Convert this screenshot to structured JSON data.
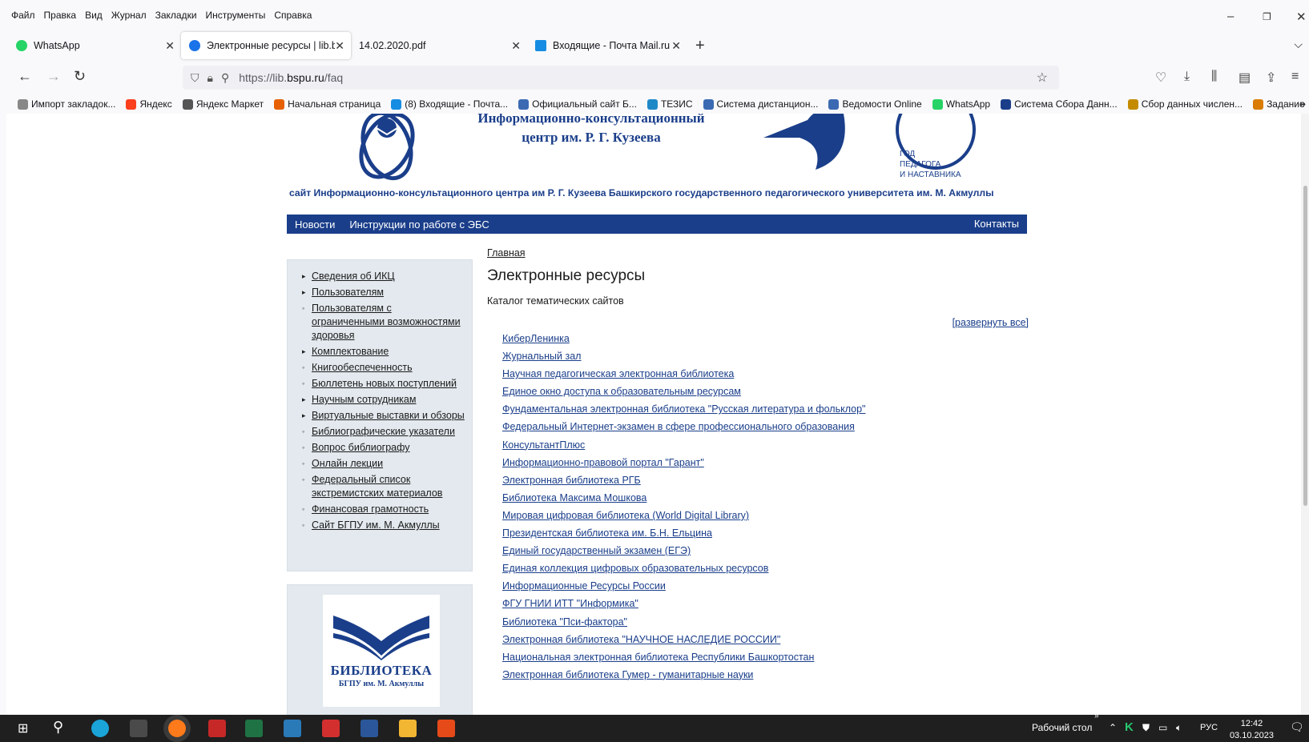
{
  "menu": [
    "Файл",
    "Правка",
    "Вид",
    "Журнал",
    "Закладки",
    "Инструменты",
    "Справка"
  ],
  "tabs": [
    {
      "label": "WhatsApp",
      "active": false,
      "icon_color": "#25d366",
      "icon": "whatsapp-icon"
    },
    {
      "label": "Электронные ресурсы | lib.bsp",
      "active": true,
      "icon_color": "#1a73e8",
      "icon": "drupal-icon"
    },
    {
      "label": "14.02.2020.pdf",
      "active": false,
      "icon_color": "",
      "icon": ""
    },
    {
      "label": "Входящие - Почта Mail.ru",
      "active": false,
      "icon_color": "#168de2",
      "icon": "mail-icon"
    }
  ],
  "url": {
    "prefix": "https://lib.",
    "domain": "bspu.ru",
    "path": "/faq"
  },
  "bookmarks": [
    {
      "label": "Импорт закладок...",
      "color": "#888"
    },
    {
      "label": "Яндекс",
      "color": "#fc3f1d"
    },
    {
      "label": "Яндекс Маркет",
      "color": "#555"
    },
    {
      "label": "Начальная страница",
      "color": "#e66000"
    },
    {
      "label": "(8) Входящие - Почта...",
      "color": "#168de2"
    },
    {
      "label": "Официальный сайт Б...",
      "color": "#3b6ab3"
    },
    {
      "label": "ТЕЗИС",
      "color": "#1e88c7"
    },
    {
      "label": "Система дистанцион...",
      "color": "#3b6ab3"
    },
    {
      "label": "Ведомости Online",
      "color": "#3b6ab3"
    },
    {
      "label": "WhatsApp",
      "color": "#25d366"
    },
    {
      "label": "Система Сбора Данн...",
      "color": "#1a3e8a"
    },
    {
      "label": "Сбор данных числен...",
      "color": "#c58b00"
    },
    {
      "label": "Задание",
      "color": "#d97c00"
    }
  ],
  "header": {
    "title_line1": "Информационно-консультационный",
    "title_line2": "центр им. Р. Г. Кузеева",
    "year_text_line1": "ГОД",
    "year_text_line2": "ПЕДАГОГА",
    "year_text_line3": "И НАСТАВНИКА",
    "subtitle": "сайт Информационно-консультационного центра им Р. Г. Кузеева Башкирского государственного педагогического университета им. М. Акмуллы"
  },
  "topnav": {
    "news": "Новости",
    "instructions": "Инструкции по работе с ЭБС",
    "contacts": "Контакты"
  },
  "sidebar": [
    {
      "label": "Сведения об ИКЦ",
      "bullet": "▸"
    },
    {
      "label": "Пользователям",
      "bullet": "▸"
    },
    {
      "label": "Пользователям с ограниченными возможностями здоровья",
      "bullet": "◦"
    },
    {
      "label": "Комплектование",
      "bullet": "▸"
    },
    {
      "label": "Книгообеспеченность",
      "bullet": "◦"
    },
    {
      "label": "Бюллетень новых поступлений",
      "bullet": "◦"
    },
    {
      "label": "Научным сотрудникам",
      "bullet": "▸"
    },
    {
      "label": "Виртуальные выставки и обзоры",
      "bullet": "▸"
    },
    {
      "label": "Библиографические указатели",
      "bullet": "◦"
    },
    {
      "label": "Вопрос библиографу",
      "bullet": "◦"
    },
    {
      "label": "Онлайн лекции",
      "bullet": "◦"
    },
    {
      "label": "Федеральный список экстремистских материалов",
      "bullet": "◦"
    },
    {
      "label": "Финансовая грамотность",
      "bullet": "◦"
    },
    {
      "label": "Сайт БГПУ им. М. Акмуллы",
      "bullet": "◦"
    }
  ],
  "library": {
    "name": "БИБЛИОТЕКА",
    "sub": "БГПУ им. М. Акмуллы"
  },
  "main": {
    "breadcrumb": "Главная",
    "title": "Электронные ресурсы",
    "subtitle": "Каталог тематических сайтов",
    "expand_all": "[развернуть все]",
    "resources": [
      "КиберЛенинка",
      "Журнальный зал",
      "Научная педагогическая электронная библиотека",
      "Единое окно доступа к образовательным ресурсам",
      "Фундаментальная электронная библиотека \"Русская литература и фольклор\"",
      "Федеральный Интернет-экзамен в сфере профессионального образования",
      "КонсультантПлюс",
      "Информационно-правовой портал \"Гарант\"",
      "Электронная библиотека РГБ",
      "Библиотека Максима Мошкова",
      "Мировая цифровая библиотека (World Digital Library)",
      "Президентская библиотека им. Б.Н. Ельцина",
      "Единый государственный экзамен (ЕГЭ)",
      "Единая коллекция цифровых образовательных ресурсов",
      "Информационные Ресурсы России",
      "ФГУ ГНИИ ИТТ \"Информика\"",
      "Библиотека \"Пси-фактора\"",
      "Электронная библиотека \"НАУЧНОЕ НАСЛЕДИЕ РОССИИ\"",
      "Национальная электронная библиотека Республики Башкортостан",
      "Электронная библиотека Гумер - гуманитарные науки"
    ]
  },
  "taskbar": {
    "desktop_label": "Рабочий стол",
    "lang": "РУС",
    "time": "12:42",
    "date": "03.10.2023"
  }
}
